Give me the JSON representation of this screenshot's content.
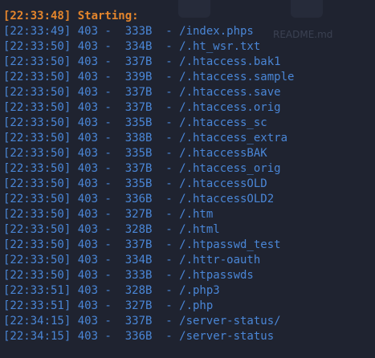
{
  "terminal": {
    "start_line": "[22:33:48] Starting: ",
    "background_hint": {
      "filename": "README.md"
    },
    "entries": [
      {
        "time": "22:33:49",
        "status": "403",
        "size": "333B",
        "path": "/index.phps"
      },
      {
        "time": "22:33:50",
        "status": "403",
        "size": "334B",
        "path": "/.ht_wsr.txt"
      },
      {
        "time": "22:33:50",
        "status": "403",
        "size": "337B",
        "path": "/.htaccess.bak1"
      },
      {
        "time": "22:33:50",
        "status": "403",
        "size": "339B",
        "path": "/.htaccess.sample"
      },
      {
        "time": "22:33:50",
        "status": "403",
        "size": "337B",
        "path": "/.htaccess.save"
      },
      {
        "time": "22:33:50",
        "status": "403",
        "size": "337B",
        "path": "/.htaccess.orig"
      },
      {
        "time": "22:33:50",
        "status": "403",
        "size": "335B",
        "path": "/.htaccess_sc"
      },
      {
        "time": "22:33:50",
        "status": "403",
        "size": "338B",
        "path": "/.htaccess_extra"
      },
      {
        "time": "22:33:50",
        "status": "403",
        "size": "335B",
        "path": "/.htaccessBAK"
      },
      {
        "time": "22:33:50",
        "status": "403",
        "size": "337B",
        "path": "/.htaccess_orig"
      },
      {
        "time": "22:33:50",
        "status": "403",
        "size": "335B",
        "path": "/.htaccessOLD"
      },
      {
        "time": "22:33:50",
        "status": "403",
        "size": "336B",
        "path": "/.htaccessOLD2"
      },
      {
        "time": "22:33:50",
        "status": "403",
        "size": "327B",
        "path": "/.htm"
      },
      {
        "time": "22:33:50",
        "status": "403",
        "size": "328B",
        "path": "/.html"
      },
      {
        "time": "22:33:50",
        "status": "403",
        "size": "337B",
        "path": "/.htpasswd_test"
      },
      {
        "time": "22:33:50",
        "status": "403",
        "size": "334B",
        "path": "/.httr-oauth"
      },
      {
        "time": "22:33:50",
        "status": "403",
        "size": "333B",
        "path": "/.htpasswds"
      },
      {
        "time": "22:33:51",
        "status": "403",
        "size": "328B",
        "path": "/.php3"
      },
      {
        "time": "22:33:51",
        "status": "403",
        "size": "327B",
        "path": "/.php"
      },
      {
        "time": "22:34:15",
        "status": "403",
        "size": "337B",
        "path": "/server-status/"
      },
      {
        "time": "22:34:15",
        "status": "403",
        "size": "336B",
        "path": "/server-status"
      }
    ]
  },
  "colors": {
    "background": "#1f2330",
    "log_text": "#4a86d6",
    "start_text": "#e4852c"
  }
}
